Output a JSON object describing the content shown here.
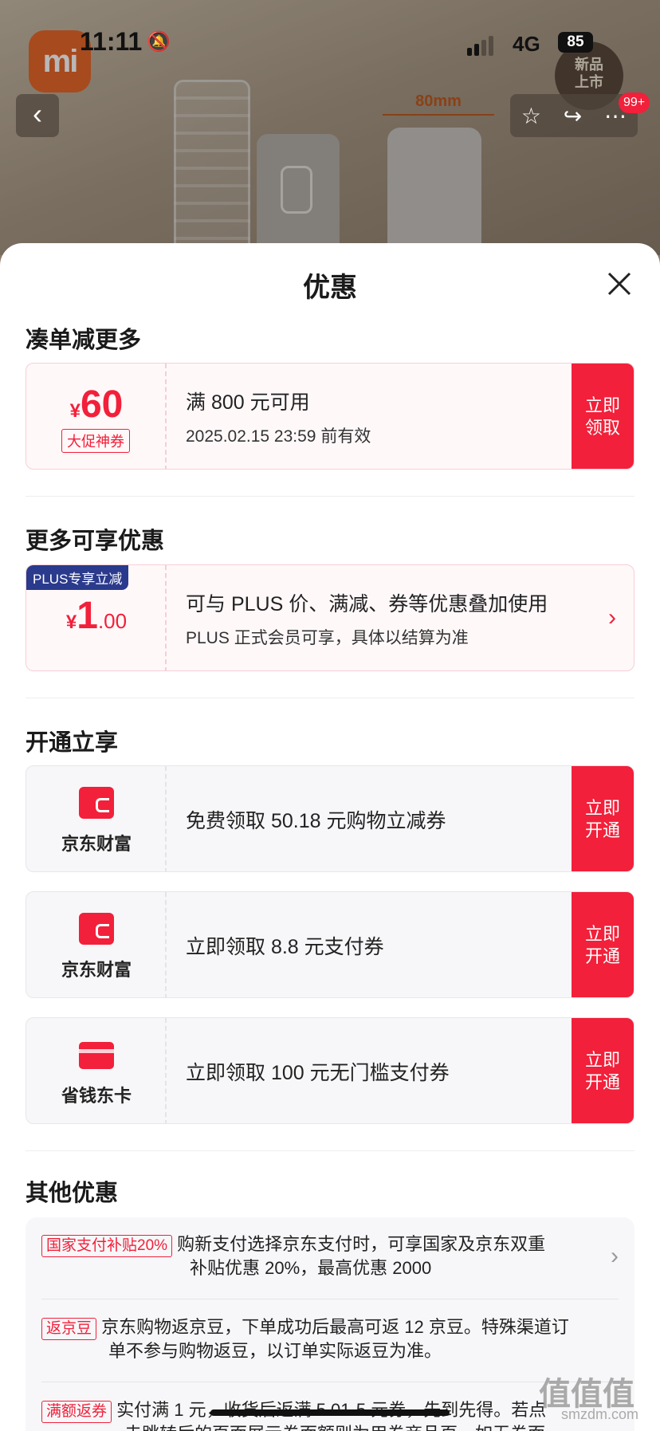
{
  "status_bar": {
    "time": "11:11",
    "network": "4G",
    "battery": "85"
  },
  "nav": {
    "back_icon": "‹",
    "badge_count": "99+"
  },
  "product": {
    "dimension_label": "80mm",
    "badge_line1": "新品",
    "badge_line2": "上市",
    "logo_text": "mi"
  },
  "sheet": {
    "title": "优惠",
    "section1": {
      "heading": "凑单减更多",
      "coupon": {
        "currency": "¥",
        "amount": "60",
        "tag": "大促神券",
        "line1": "满 800 元可用",
        "line2": "2025.02.15 23:59 前有效",
        "action_line1": "立即",
        "action_line2": "领取"
      }
    },
    "section2": {
      "heading": "更多可享优惠",
      "plus": {
        "tag": "PLUS专享立减",
        "currency": "¥",
        "amount_int": "1",
        "amount_dec": ".00",
        "line1": "可与 PLUS 价、满减、券等优惠叠加使用",
        "line2": "PLUS 正式会员可享，具体以结算为准"
      }
    },
    "section3": {
      "heading": "开通立享",
      "cards": [
        {
          "brand": "京东财富",
          "text": "免费领取 50.18 元购物立减券",
          "action_line1": "立即",
          "action_line2": "开通"
        },
        {
          "brand": "京东财富",
          "text": "立即领取 8.8 元支付券",
          "action_line1": "立即",
          "action_line2": "开通"
        },
        {
          "brand": "省钱东卡",
          "text": "立即领取 100 元无门槛支付券",
          "action_line1": "立即",
          "action_line2": "开通"
        }
      ]
    },
    "section4": {
      "heading": "其他优惠",
      "rows": [
        {
          "tag": "国家支付补贴20%",
          "text1": "购新支付选择京东支付时，可享国家及京东双重",
          "text2": "补贴优惠 20%，最高优惠 2000"
        },
        {
          "tag": "返京豆",
          "text1": "京东购物返京豆，下单成功后最高可返 12 京豆。特殊渠道订",
          "text2": "单不参与购物返豆，以订单实际返豆为准。"
        },
        {
          "tag": "满额返券",
          "text1": "实付满 1 元，收货后返满 5.01-5 元券，先到先得。若点",
          "text2": "击跳转后的页面展示券面额则为用券商品页，如无券面"
        }
      ]
    }
  },
  "watermark": {
    "text": "值值值",
    "sub": "smzdm.com"
  }
}
